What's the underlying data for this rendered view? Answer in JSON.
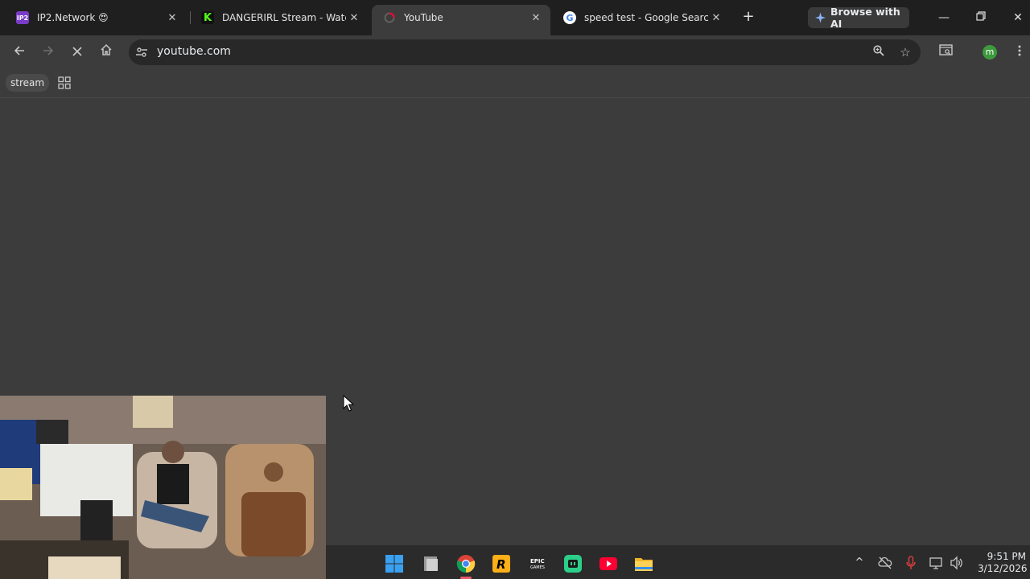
{
  "tabs": [
    {
      "label": "IP2.Network 😍",
      "favicon_text": "IP2",
      "favicon_color": "#7a3cc8"
    },
    {
      "label": "DANGERIRL Stream - Watch Live on Kick",
      "favicon_text": "K",
      "favicon_color": "#53fc18"
    },
    {
      "label": "YouTube",
      "favicon_text": "",
      "favicon_color": "#ff0033"
    },
    {
      "label": "speed test - Google Search",
      "favicon_text": "G",
      "favicon_color": "#ffffff"
    }
  ],
  "browse_ai_label": "Browse with AI",
  "address": {
    "url": "youtube.com"
  },
  "bookmarks": {
    "stream_label": "stream"
  },
  "avatar_letter": "m",
  "clock": {
    "time": "9:51 PM",
    "date": "3/12/2026"
  },
  "colors": {
    "accent_avatar": "#3d9a3d",
    "youtube_red": "#ff0033",
    "kick_green": "#53fc18"
  }
}
